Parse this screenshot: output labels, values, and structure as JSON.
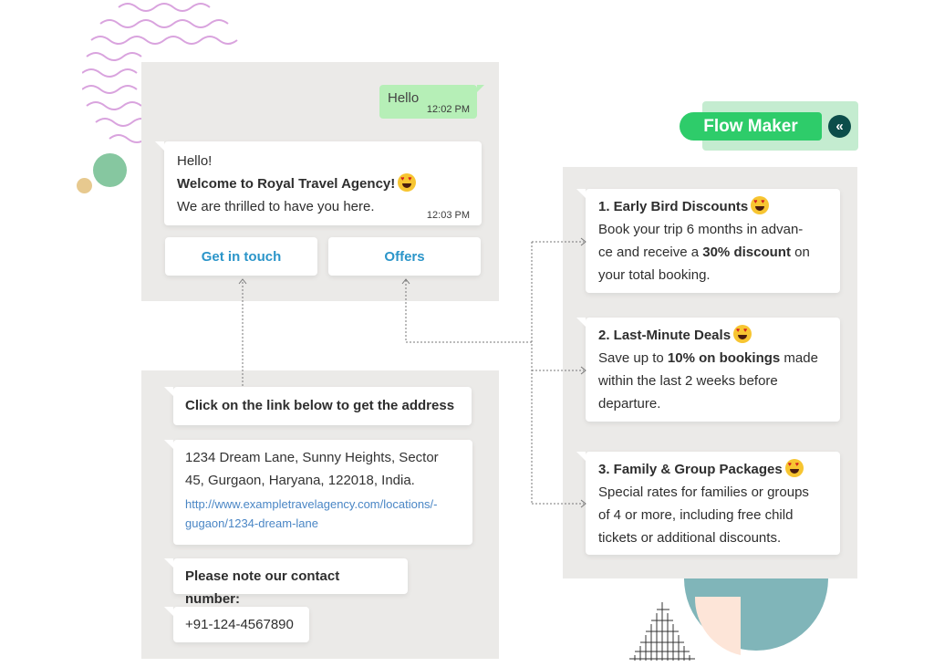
{
  "chat_top": {
    "outgoing": {
      "text": "Hello",
      "time": "12:02 PM"
    },
    "incoming": {
      "line1": "Hello!",
      "line2": "Welcome to Royal Travel Agency!",
      "line3": "We are thrilled to have you here.",
      "time": "12:03 PM",
      "emoji": "heart-eyes-emoji"
    },
    "buttons": [
      {
        "label": "Get in touch"
      },
      {
        "label": "Offers"
      }
    ]
  },
  "chat_bottom": {
    "messages": [
      {
        "text": "Click on the link below to get the address"
      },
      {
        "address_line1": "1234 Dream Lane, Sunny Heights, Sector",
        "address_line2": "45, Gurgaon, Haryana, 122018, India.",
        "link_line1": "http://www.exampletravelagency.com/locations/-",
        "link_line2": "gugaon/1234-dream-lane"
      },
      {
        "text": "Please note our contact number:"
      },
      {
        "text": "+91-124-4567890"
      }
    ]
  },
  "flow_maker": {
    "label": "Flow Maker",
    "collapse_icon": "double-chevron-left-icon"
  },
  "offers": [
    {
      "title": "1. Early Bird Discounts",
      "line1": "Book your trip 6 months in advan-",
      "line2_pre": "ce and receive a ",
      "line2_bold": "30% discount",
      "line2_post": " on",
      "line3": "your total booking."
    },
    {
      "title": "2. Last-Minute Deals",
      "line1_pre": "Save up to ",
      "line1_bold": "10% on bookings",
      "line1_post": " made",
      "line2": "within the last 2 weeks before",
      "line3": "departure."
    },
    {
      "title": "3. Family & Group Packages",
      "line1": "Special rates for families or groups",
      "line2": "of 4 or more, including free child",
      "line3": "tickets or additional discounts."
    }
  ],
  "colors": {
    "panel_bg": "#ebeae8",
    "outgoing_bubble": "#b6efb7",
    "button_text": "#2b95c9",
    "link": "#4a86c5",
    "flow_pill": "#2ecc6a",
    "flow_bg": "#c4ecd0",
    "collapse_button": "#0c4d4a",
    "wave_decoration": "#d9a3de",
    "dot_green": "#86c7a0",
    "dot_yellow": "#e7c98f",
    "half_circle": "#80b5b9",
    "quarter_shape": "#fde5d8"
  }
}
